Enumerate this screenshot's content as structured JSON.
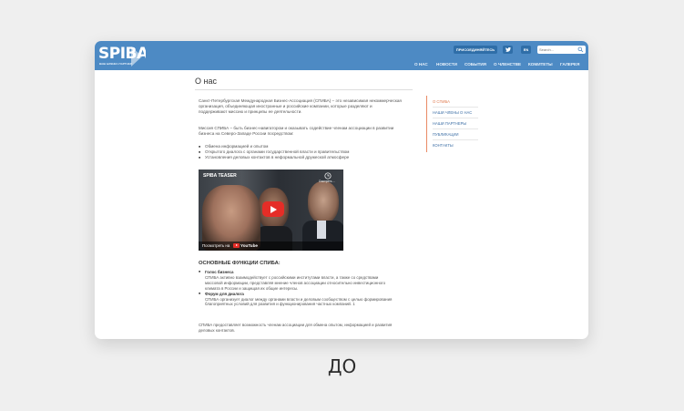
{
  "header": {
    "logo": "SPIBA",
    "logo_tagline": "ВАШ БИЗНЕС-ПАРТНЕР",
    "join_button": "ПРИСОЕДИНЯЙТЕСЬ",
    "twitter_icon": "twitter-icon",
    "lang_button": "EN",
    "search_placeholder": "Search...",
    "nav": [
      "О НАС",
      "НОВОСТИ",
      "СОБЫТИЯ",
      "О ЧЛЕНСТВЕ",
      "КОМИТЕТЫ",
      "ГАЛЕРЕЯ"
    ],
    "accent_color": "#4d8ac4"
  },
  "main": {
    "title": "О нас",
    "intro_lines": [
      "Санкт-Петербургская Международная Бизнес-Ассоциация (СПИБА) – это независимая некоммерческая",
      "организация, объединяющая иностранные и российские компании, которые разделяют и",
      "поддерживают миссию и принципы ее деятельности."
    ],
    "mission_lines": [
      "Миссия СПИБА – быть бизнес-навигатором и оказывать содействие членам ассоциации в развитии",
      "бизнеса на Северо-Западе России посредством:"
    ],
    "bullets": [
      "Обмена информацией и опытом",
      "Открытого диалога с органами государственной власти и правительством",
      "Установления деловых контактов в неформальной дружеской атмосфере"
    ],
    "video": {
      "title": "SPIBA TEASER",
      "share_label": "Смотреть ...",
      "watch_on": "Посмотреть на",
      "platform": "YouTube"
    },
    "functions_heading": "ОСНОВНЫЕ ФУНКЦИИ СПИБА:",
    "functions": [
      {
        "heading": "Голос бизнеса",
        "lines": [
          "СПИБА активно взаимодействует с российскими институтами власти, а также со средствами",
          "массовой информации, представляя мнение членов ассоциации относительно инвестиционного",
          "климата в России и защищая их общие интересы."
        ]
      },
      {
        "heading": "Форум для диалога",
        "lines": [
          "СПИБА организует диалог между органами власти и деловым сообществом с целью формирования",
          "благоприятных условий для развития и функционирования частных компаний. 1"
        ]
      }
    ],
    "closing_lines": [
      "СПИБА предоставляет возможность членам ассоциации для обмена опытом, информацией и развития",
      "деловых контактов."
    ]
  },
  "sidebar": {
    "items": [
      "О СПИБА",
      "НАШИ ЧЛЕНЫ О НАС",
      "НАШИ ПАРТНЕРЫ",
      "ПУБЛИКАЦИИ",
      "КОНТАКТЫ"
    ],
    "active_color": "#e07a4f"
  },
  "caption": "ДО"
}
